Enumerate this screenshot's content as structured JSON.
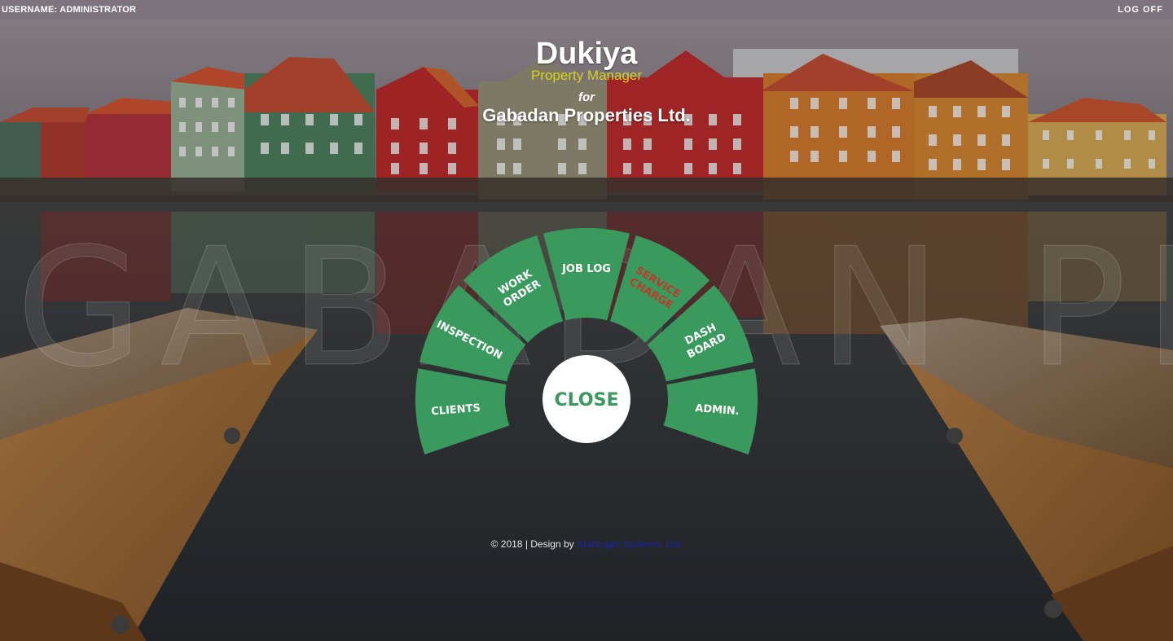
{
  "header": {
    "username": "USERNAME: ADMINISTRATOR",
    "logoff_label": "LOG OFF"
  },
  "brand": {
    "title": "Dukiya",
    "subtitle": "Property Manager",
    "for": "for",
    "company": "Gabadan Properties Ltd."
  },
  "watermark": "GABADAN PROP",
  "menu": {
    "items": [
      {
        "id": "clients",
        "lines": [
          "CLIENTS"
        ],
        "highlight": false
      },
      {
        "id": "inspection",
        "lines": [
          "INSPECTION"
        ],
        "highlight": false
      },
      {
        "id": "work-order",
        "lines": [
          "WORK",
          "ORDER"
        ],
        "highlight": false
      },
      {
        "id": "job-log",
        "lines": [
          "JOB LOG"
        ],
        "highlight": false
      },
      {
        "id": "service-charge",
        "lines": [
          "SERVICE",
          "CHARGE"
        ],
        "highlight": true
      },
      {
        "id": "dashboard",
        "lines": [
          "DASH",
          "BOARD"
        ],
        "highlight": false
      },
      {
        "id": "admin",
        "lines": [
          "ADMIN."
        ],
        "highlight": false
      }
    ],
    "close_label": "CLOSE"
  },
  "footer": {
    "copyright": "© 2018 | Design by ",
    "link_text": "StanLogic Systems, Ltd."
  },
  "colors": {
    "accent": "#3a9a5d",
    "highlight_text": "#c0392b",
    "subtitle": "#d6d21c",
    "link": "#1a23a8"
  }
}
